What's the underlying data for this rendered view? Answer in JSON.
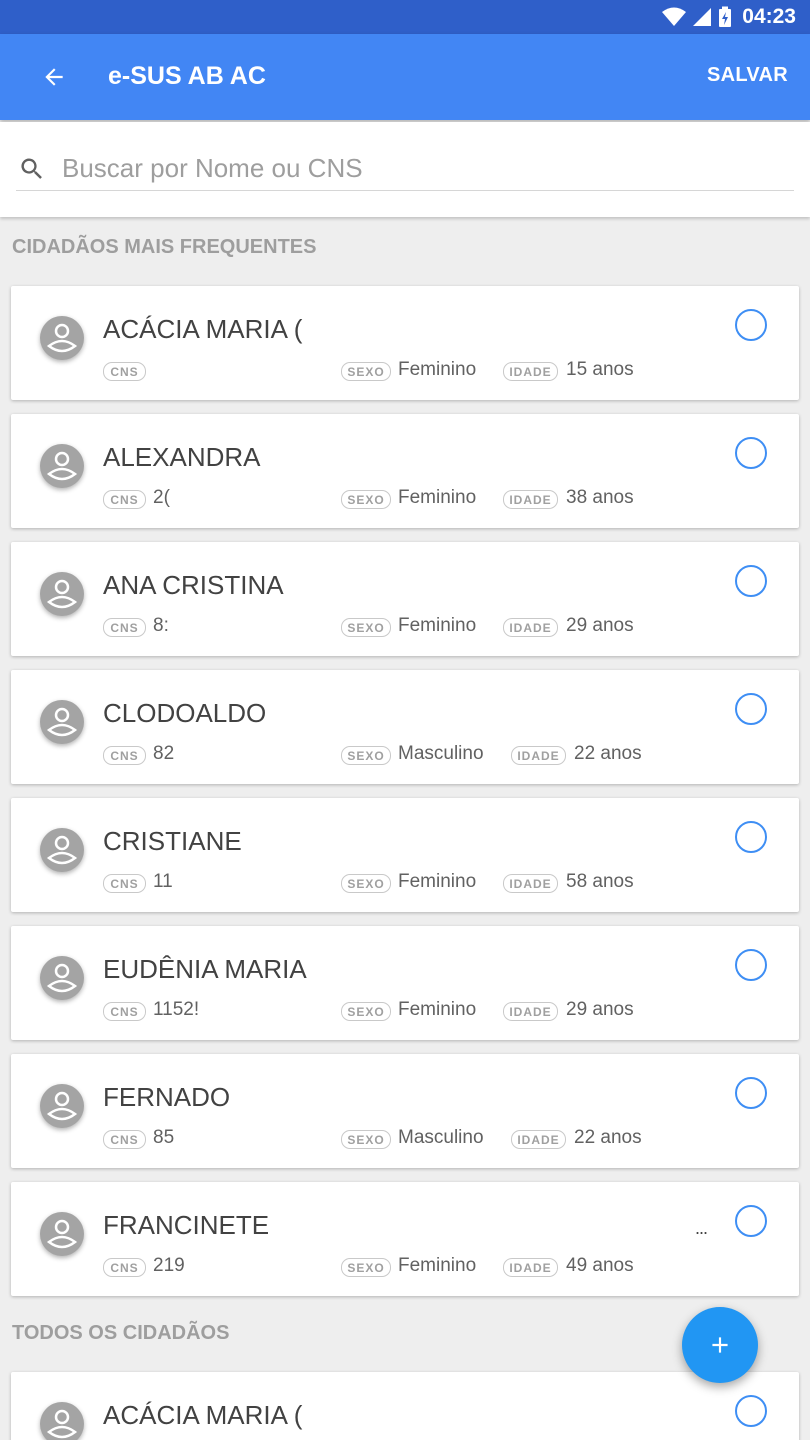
{
  "status_bar": {
    "time": "04:23"
  },
  "app_bar": {
    "title": "e-SUS AB AC",
    "save_label": "SALVAR"
  },
  "search": {
    "placeholder": "Buscar por Nome ou CNS",
    "value": ""
  },
  "sections": {
    "frequent": "CIDADÃOS MAIS FREQUENTES",
    "all": "TODOS OS CIDADÃOS"
  },
  "tags": {
    "cns": "CNS",
    "sexo": "SEXO",
    "idade": "IDADE"
  },
  "frequent_citizens": [
    {
      "name": "ACÁCIA MARIA (",
      "cns": "",
      "sexo": "Feminino",
      "idade": "15 anos"
    },
    {
      "name": "ALEXANDRA",
      "cns": "2(",
      "sexo": "Feminino",
      "idade": "38 anos"
    },
    {
      "name": "ANA CRISTINA",
      "cns": "8:",
      "sexo": "Feminino",
      "idade": "29 anos"
    },
    {
      "name": "CLODOALDO",
      "cns": "82",
      "sexo": "Masculino",
      "idade": "22 anos"
    },
    {
      "name": "CRISTIANE",
      "cns": "11",
      "sexo": "Feminino",
      "idade": "58 anos"
    },
    {
      "name": "EUDÊNIA MARIA",
      "cns": "1152!",
      "sexo": "Feminino",
      "idade": "29 anos"
    },
    {
      "name": "FERNADO",
      "cns": "85",
      "sexo": "Masculino",
      "idade": "22 anos"
    },
    {
      "name": "FRANCINETE",
      "cns": "219",
      "sexo": "Feminino",
      "idade": "49 anos",
      "trailing": "..."
    }
  ],
  "all_citizens": [
    {
      "name": "ACÁCIA MARIA ("
    }
  ],
  "colors": {
    "status_bar": "#2f5fc9",
    "app_bar": "#4286f4",
    "accent": "#2196f3",
    "radio": "#3e8ef4"
  },
  "icons": {
    "back": "arrow-left-icon",
    "search": "search-icon",
    "avatar": "person-avatar-icon",
    "fab": "plus-icon"
  }
}
